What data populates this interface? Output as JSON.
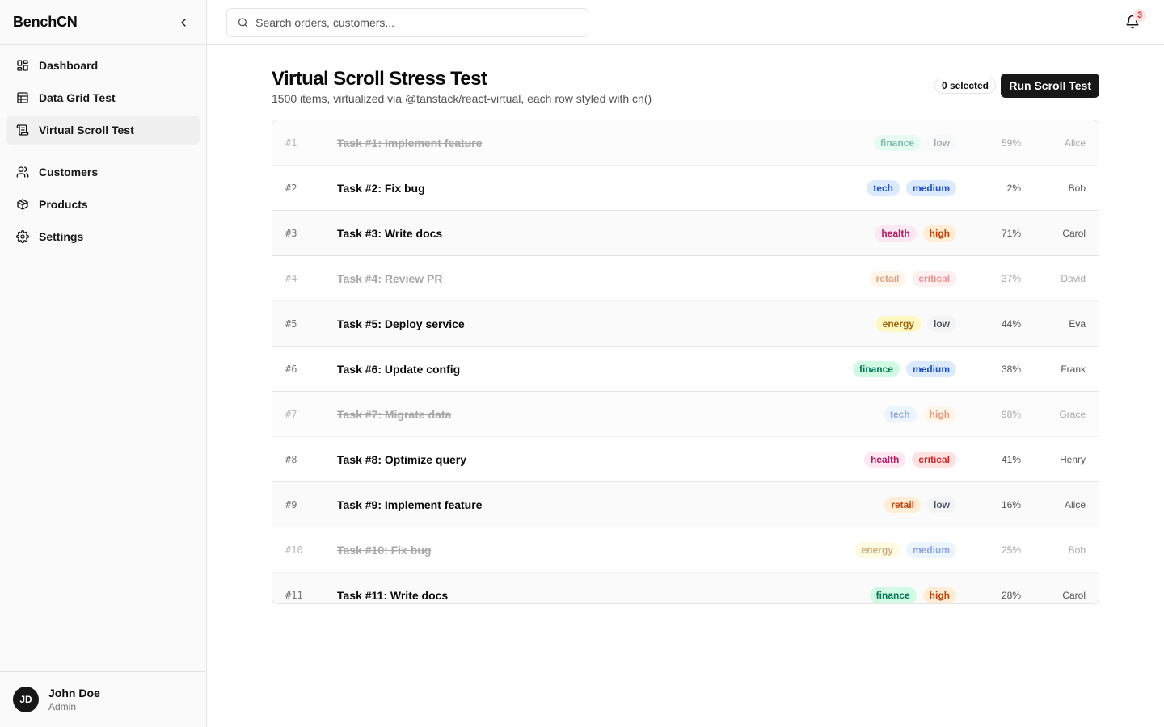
{
  "sidebar": {
    "brand": "BenchCN",
    "nav_primary": [
      {
        "label": "Dashboard",
        "icon": "dashboard-icon"
      },
      {
        "label": "Data Grid Test",
        "icon": "table-icon"
      },
      {
        "label": "Virtual Scroll Test",
        "icon": "scroll-icon",
        "active": true
      }
    ],
    "nav_secondary": [
      {
        "label": "Customers",
        "icon": "users-icon"
      },
      {
        "label": "Products",
        "icon": "package-icon"
      },
      {
        "label": "Settings",
        "icon": "gear-icon"
      }
    ],
    "user": {
      "initials": "JD",
      "name": "John Doe",
      "role": "Admin"
    }
  },
  "header": {
    "search_placeholder": "Search orders, customers...",
    "notification_count": "3"
  },
  "page": {
    "title": "Virtual Scroll Stress Test",
    "subtitle": "1500 items, virtualized via @tanstack/react-virtual, each row styled with cn()",
    "selected_label": "0 selected",
    "run_button": "Run Scroll Test"
  },
  "colors": {
    "finance": {
      "bg": "#d1fae5",
      "fg": "#047857"
    },
    "tech": {
      "bg": "#dbeafe",
      "fg": "#1d4ed8"
    },
    "health": {
      "bg": "#fce7f3",
      "fg": "#be185d"
    },
    "retail": {
      "bg": "#ffedd5",
      "fg": "#c2410c"
    },
    "energy": {
      "bg": "#fef9c3",
      "fg": "#a16207"
    },
    "low": {
      "bg": "#f3f4f6",
      "fg": "#4b5563"
    },
    "medium": {
      "bg": "#dbeafe",
      "fg": "#1d4ed8"
    },
    "high": {
      "bg": "#ffedd5",
      "fg": "#c2410c"
    },
    "critical": {
      "bg": "#fee2e2",
      "fg": "#dc2626"
    }
  },
  "rows": [
    {
      "num": "#1",
      "title": "Task #1: Implement feature",
      "category": "finance",
      "priority": "low",
      "pct": "59%",
      "owner": "Alice",
      "done": true
    },
    {
      "num": "#2",
      "title": "Task #2: Fix bug",
      "category": "tech",
      "priority": "medium",
      "pct": "2%",
      "owner": "Bob",
      "done": false
    },
    {
      "num": "#3",
      "title": "Task #3: Write docs",
      "category": "health",
      "priority": "high",
      "pct": "71%",
      "owner": "Carol",
      "done": false
    },
    {
      "num": "#4",
      "title": "Task #4: Review PR",
      "category": "retail",
      "priority": "critical",
      "pct": "37%",
      "owner": "David",
      "done": true
    },
    {
      "num": "#5",
      "title": "Task #5: Deploy service",
      "category": "energy",
      "priority": "low",
      "pct": "44%",
      "owner": "Eva",
      "done": false
    },
    {
      "num": "#6",
      "title": "Task #6: Update config",
      "category": "finance",
      "priority": "medium",
      "pct": "38%",
      "owner": "Frank",
      "done": false
    },
    {
      "num": "#7",
      "title": "Task #7: Migrate data",
      "category": "tech",
      "priority": "high",
      "pct": "98%",
      "owner": "Grace",
      "done": true
    },
    {
      "num": "#8",
      "title": "Task #8: Optimize query",
      "category": "health",
      "priority": "critical",
      "pct": "41%",
      "owner": "Henry",
      "done": false
    },
    {
      "num": "#9",
      "title": "Task #9: Implement feature",
      "category": "retail",
      "priority": "low",
      "pct": "16%",
      "owner": "Alice",
      "done": false
    },
    {
      "num": "#10",
      "title": "Task #10: Fix bug",
      "category": "energy",
      "priority": "medium",
      "pct": "25%",
      "owner": "Bob",
      "done": true
    },
    {
      "num": "#11",
      "title": "Task #11: Write docs",
      "category": "finance",
      "priority": "high",
      "pct": "28%",
      "owner": "Carol",
      "done": false
    }
  ]
}
